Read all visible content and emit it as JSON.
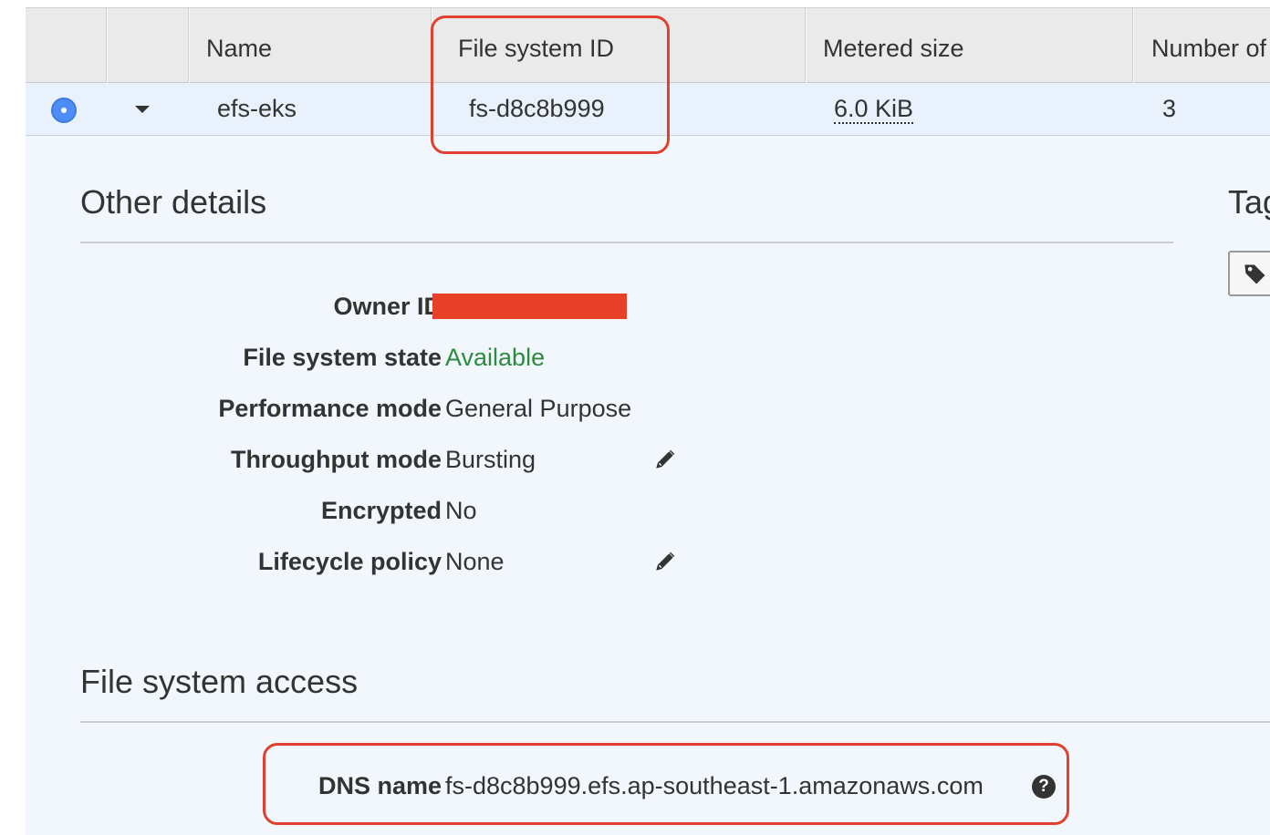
{
  "table": {
    "columns": [
      "",
      "",
      "Name",
      "File system ID",
      "Metered size",
      "Number of"
    ],
    "row": {
      "selected": true,
      "name": "efs-eks",
      "file_system_id": "fs-d8c8b999",
      "metered_size": "6.0 KiB",
      "number_of": "3"
    }
  },
  "other_details": {
    "title": "Other details",
    "fields": [
      {
        "label": "Owner ID",
        "value": "",
        "redacted": true
      },
      {
        "label": "File system state",
        "value": "Available"
      },
      {
        "label": "Performance mode",
        "value": "General Purpose"
      },
      {
        "label": "Throughput mode",
        "value": "Bursting",
        "editable": true
      },
      {
        "label": "Encrypted",
        "value": "No"
      },
      {
        "label": "Lifecycle policy",
        "value": "None",
        "editable": true
      }
    ]
  },
  "tags": {
    "title": "Tag",
    "button_icon": "tag-icon"
  },
  "file_system_access": {
    "title": "File system access",
    "dns_label": "DNS name",
    "dns_value": "fs-d8c8b999.efs.ap-southeast-1.amazonaws.com",
    "help_icon": "question-circle-icon"
  },
  "colors": {
    "header_bg": "#eaeaea",
    "selected_row_bg": "#e9f2fc",
    "panel_bg": "#f1f7fc",
    "available_green": "#2e8b3e",
    "highlight_red": "#e0412f",
    "redaction_red": "#e8412a",
    "radio_blue": "#4f8df6"
  }
}
